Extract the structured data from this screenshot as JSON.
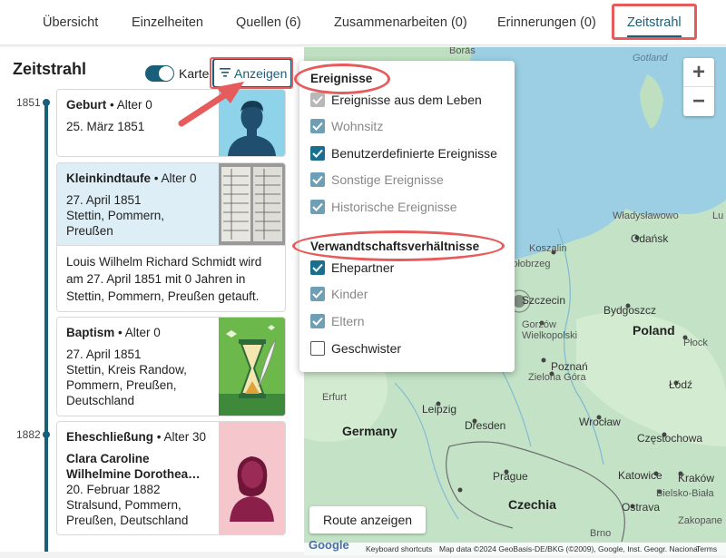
{
  "tabs": [
    {
      "label": "Übersicht"
    },
    {
      "label": "Einzelheiten"
    },
    {
      "label": "Quellen (6)"
    },
    {
      "label": "Zusammenarbeiten (0)"
    },
    {
      "label": "Erinnerungen (0)"
    },
    {
      "label": "Zeitstrahl",
      "active": true
    }
  ],
  "timeline": {
    "title": "Zeitstrahl",
    "map_toggle_label": "Karte",
    "map_toggle_on": true,
    "filter_button_label": "Anzeigen",
    "years": [
      "1851",
      "1882"
    ],
    "events": [
      {
        "title": "Geburt",
        "age": "• Alter 0",
        "date": "25. März 1851",
        "place": "",
        "thumb": "person-silhouette-icon"
      },
      {
        "title": "Kleinkindtaufe",
        "age": "• Alter 0",
        "date": "27. April 1851",
        "place": "Stettin, Pommern, Preußen",
        "thumb": "document-scan",
        "description": "Louis Wilhelm Richard Schmidt wird am 27. April 1851 mit 0 Jahren in Stettin, Pommern, Preußen getauft."
      },
      {
        "title": "Baptism",
        "age": "• Alter 0",
        "date": "27. April 1851",
        "place": "Stettin, Kreis Randow, Pommern, Preußen, Deutschland",
        "thumb": "hourglass-quill-icon"
      },
      {
        "title": "Eheschließung",
        "age": "• Alter 30",
        "spouse": "Clara Caroline Wilhelmine Dorothea…",
        "date": "20. Februar 1882",
        "place": "Stralsund, Pommern, Preußen, Deutschland",
        "thumb": "female-silhouette-icon"
      }
    ]
  },
  "filter_menu": {
    "sections": [
      {
        "heading": "Ereignisse",
        "items": [
          {
            "label": "Ereignisse aus dem Leben",
            "state": "disabled-checked"
          },
          {
            "label": "Wohnsitz",
            "state": "checked-dim"
          },
          {
            "label": "Benutzerdefinierte Ereignisse",
            "state": "checked"
          },
          {
            "label": "Sonstige Ereignisse",
            "state": "checked-dim"
          },
          {
            "label": "Historische Ereignisse",
            "state": "checked-dim"
          }
        ]
      },
      {
        "heading": "Verwandtschaftsverhältnisse",
        "items": [
          {
            "label": "Ehepartner",
            "state": "checked"
          },
          {
            "label": "Kinder",
            "state": "checked-dim"
          },
          {
            "label": "Eltern",
            "state": "checked-dim"
          },
          {
            "label": "Geschwister",
            "state": "unchecked"
          }
        ]
      }
    ]
  },
  "map": {
    "zoom_in": "+",
    "zoom_out": "−",
    "route_button": "Route anzeigen",
    "logo": "Google",
    "labels": {
      "boras": "Borås",
      "gotland": "Gotland",
      "wladyslawowo": "Władysławowo",
      "gdansk": "Gdańsk",
      "koszalin": "Koszalin",
      "kolobrzeg": "Kołobrzeg",
      "szczecin": "Szczecin",
      "bydgoszcz": "Bydgoszcz",
      "gorzow": "Gorzów Wielkopolski",
      "poland": "Poland",
      "plock": "Płock",
      "poznan": "Poznań",
      "zielona": "Zielona Góra",
      "lodz": "Łódź",
      "leipzig": "Leipzig",
      "germany": "Germany",
      "dresden": "Dresden",
      "wroclaw": "Wrocław",
      "czestochowa": "Częstochowa",
      "katowice": "Katowice",
      "prague": "Prague",
      "krakow": "Kraków",
      "bielsko": "Bielsko-Biała",
      "czechia": "Czechia",
      "ostrava": "Ostrava",
      "zakopane": "Zakopane",
      "brno": "Brno",
      "erfurt": "Erfurt",
      "lu": "Lu"
    },
    "attribution": {
      "shortcuts": "Keyboard shortcuts",
      "data": "Map data ©2024 GeoBasis-DE/BKG (©2009), Google, Inst. Geogr. Nacional",
      "terms": "Terms"
    }
  },
  "colors": {
    "accent": "#1a5f7a",
    "highlight": "#e65b5b",
    "card_blue": "#ddeef6"
  }
}
